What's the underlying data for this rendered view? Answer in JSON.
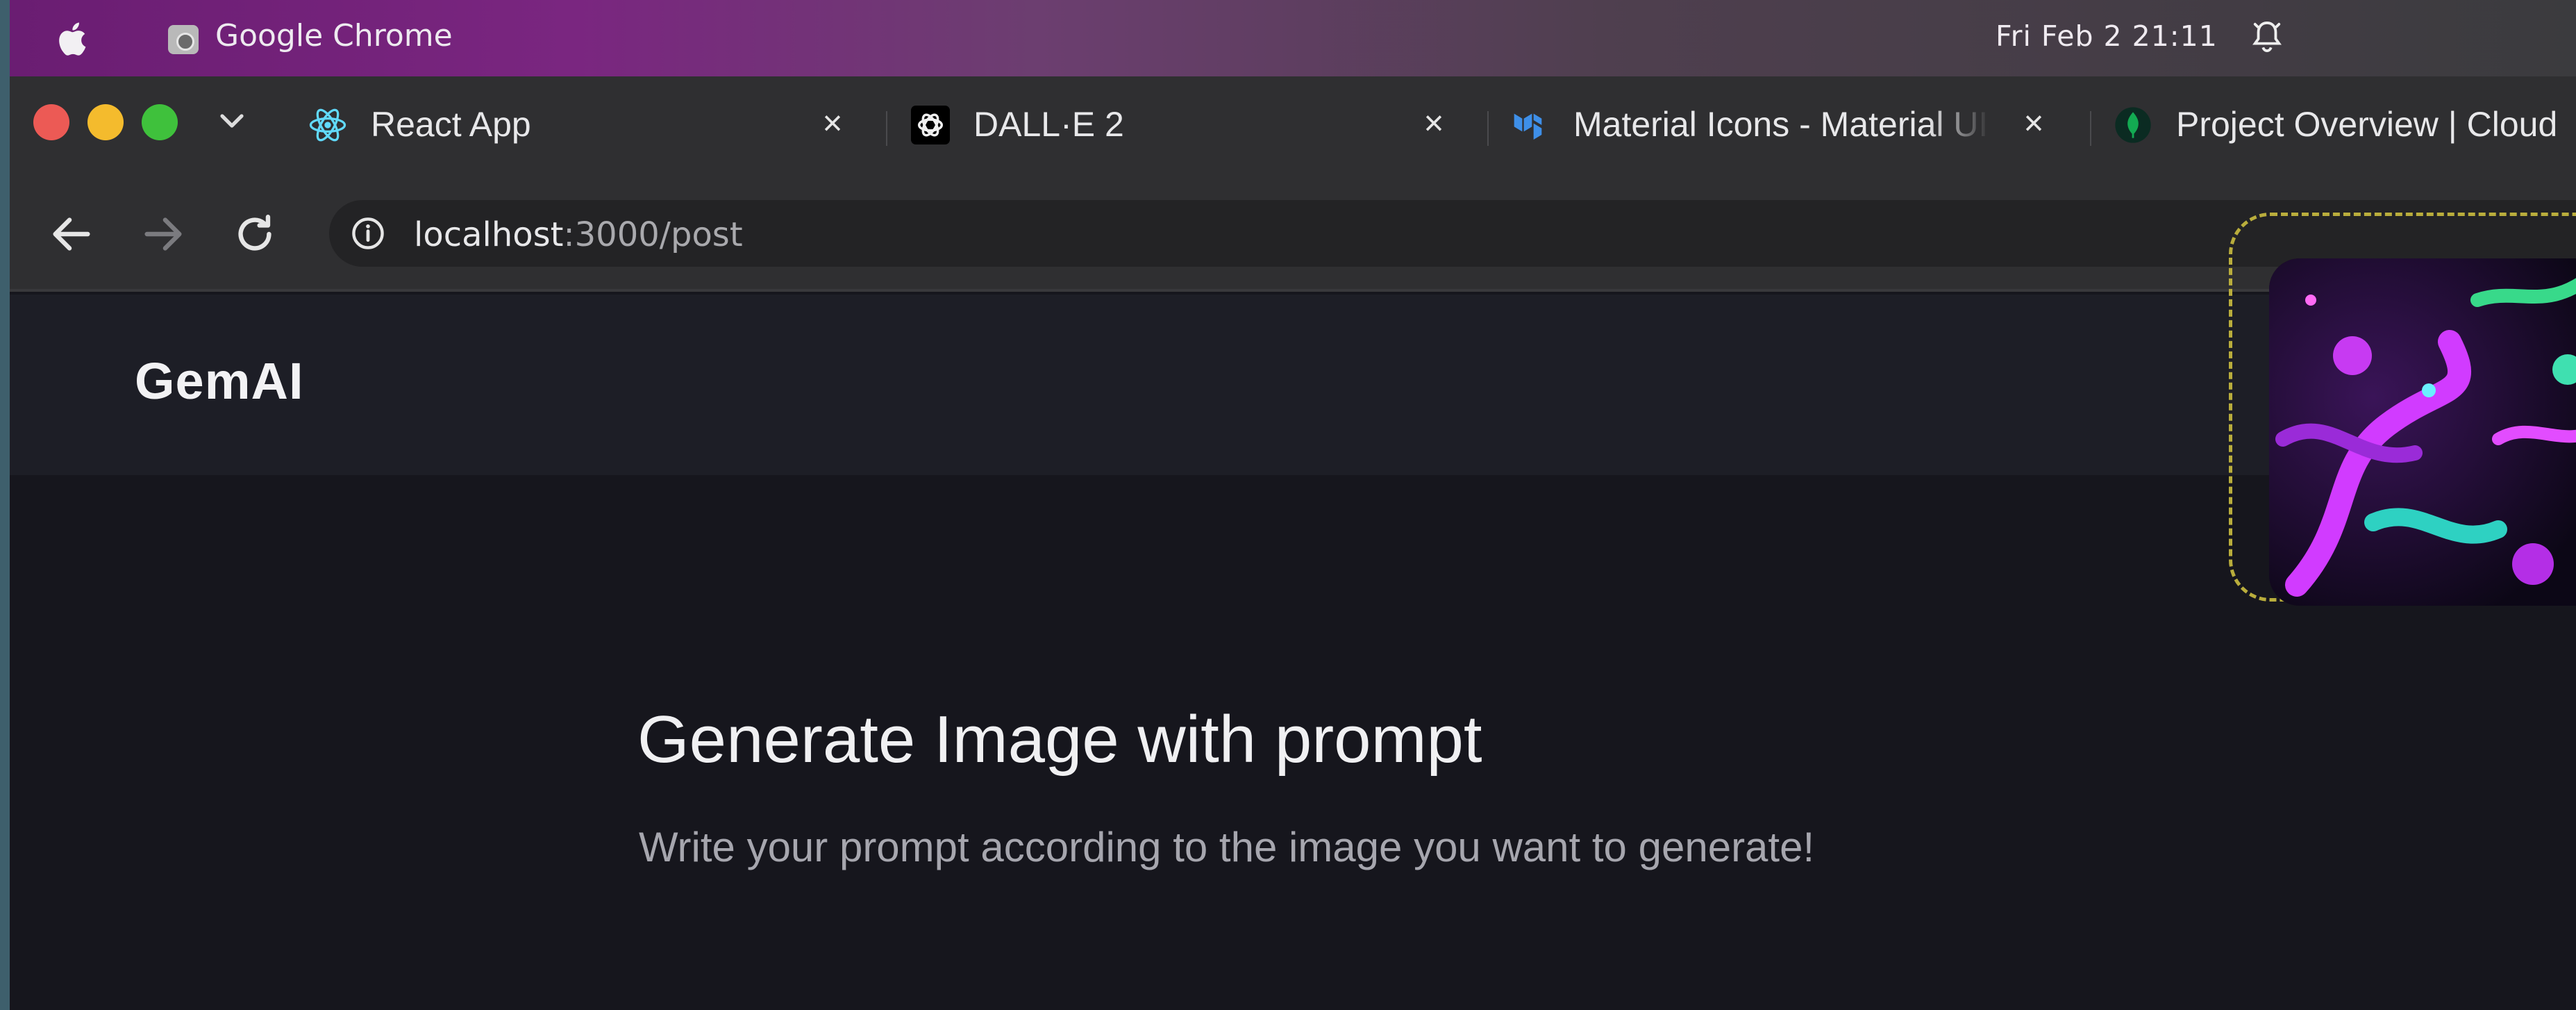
{
  "os_bar": {
    "app_name": "Google Chrome",
    "clock": "Fri Feb 2  21:11"
  },
  "tabs": [
    {
      "title": "React App",
      "close": "×",
      "icon": "react-icon"
    },
    {
      "title": "DALL·E 2",
      "close": "×",
      "icon": "openai-icon"
    },
    {
      "title": "Material Icons - Material UI",
      "close": "×",
      "icon": "mui-icon"
    },
    {
      "title": "Project Overview | Cloud",
      "icon": "mongodb-leaf-icon"
    }
  ],
  "address_bar": {
    "host": "localhost",
    "path": ":3000/post"
  },
  "page": {
    "brand": "GemAI",
    "title": "Generate Image with prompt",
    "subtitle": "Write your prompt according to the image you want to generate!"
  },
  "colors": {
    "tl_red": "#ec5a55",
    "tl_yellow": "#f4bb2d",
    "tl_green": "#3fc13c",
    "card_border": "#b9ad3c",
    "page_bg": "#16161d",
    "nav_bg": "#1d1e26"
  }
}
